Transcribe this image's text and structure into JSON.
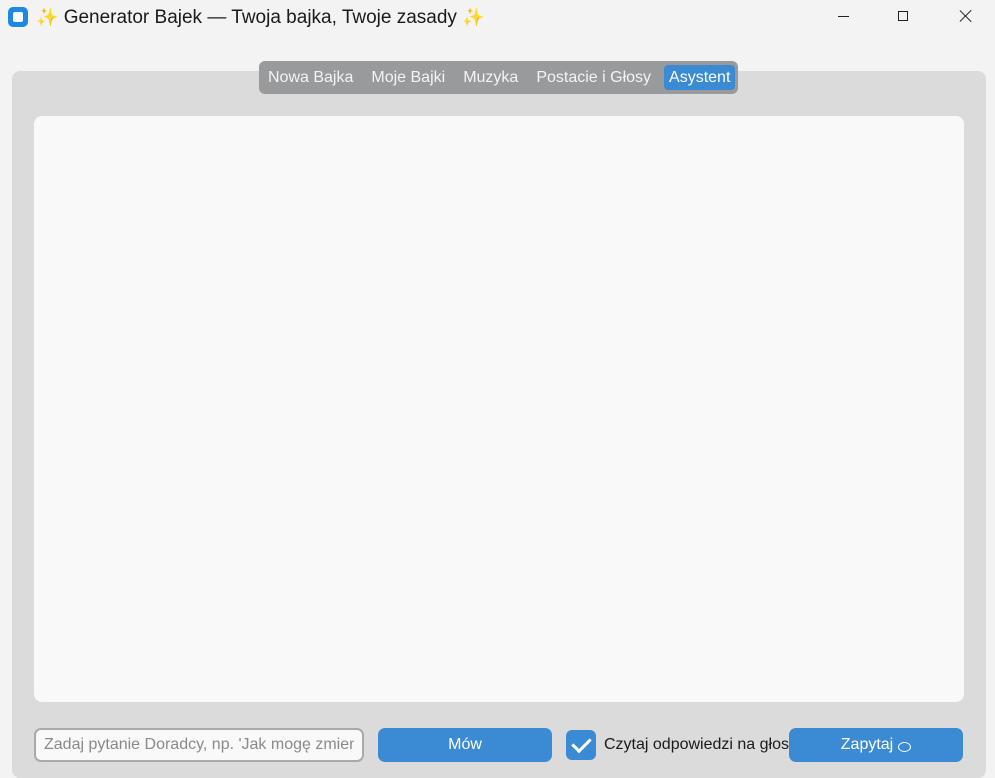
{
  "window": {
    "title": "Generator Bajek — Twoja bajka, Twoje zasady",
    "title_prefix": "✨",
    "title_suffix": "✨"
  },
  "tabs": [
    {
      "label": "Nowa Bajka",
      "active": false
    },
    {
      "label": "Moje Bajki",
      "active": false
    },
    {
      "label": "Muzyka",
      "active": false
    },
    {
      "label": "Postacie i Głosy",
      "active": false
    },
    {
      "label": "Asystent",
      "active": true
    }
  ],
  "assistant": {
    "conversation_text": "",
    "input_placeholder": "Zadaj pytanie Doradcy, np. 'Jak mogę zmienić",
    "input_value": "",
    "speak_button": "Mów",
    "read_aloud_label": "Czytaj odpowiedzi na głos",
    "read_aloud_checked": true,
    "ask_button": "Zapytaj"
  },
  "colors": {
    "accent": "#3a8bd3",
    "panel": "#dbdbdb",
    "tabbar": "#999a9c",
    "textarea": "#f9f9f9"
  }
}
